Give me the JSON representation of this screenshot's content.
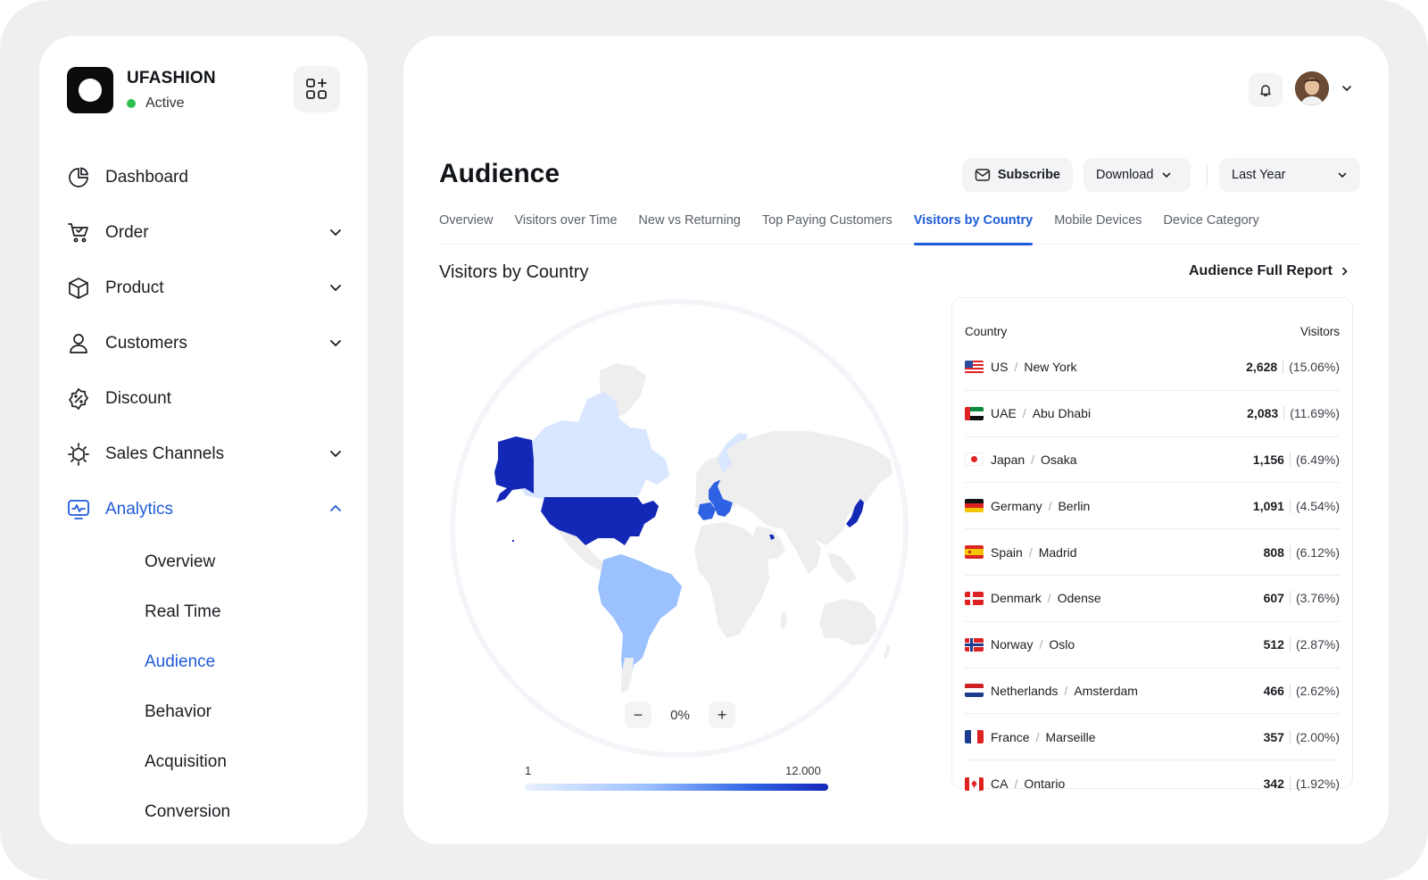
{
  "brand": {
    "name": "UFASHION",
    "status": "Active"
  },
  "nav": [
    {
      "label": "Dashboard",
      "icon": "pie-chart-icon",
      "expandable": false
    },
    {
      "label": "Order",
      "icon": "cart-icon",
      "expandable": true
    },
    {
      "label": "Product",
      "icon": "box-icon",
      "expandable": true
    },
    {
      "label": "Customers",
      "icon": "user-icon",
      "expandable": true
    },
    {
      "label": "Discount",
      "icon": "discount-badge-icon",
      "expandable": false
    },
    {
      "label": "Sales Channels",
      "icon": "channels-icon",
      "expandable": true
    },
    {
      "label": "Analytics",
      "icon": "analytics-monitor-icon",
      "expandable": true,
      "expanded": true
    }
  ],
  "analytics_sub": [
    "Overview",
    "Real Time",
    "Audience",
    "Behavior",
    "Acquisition",
    "Conversion"
  ],
  "analytics_sub_active": "Audience",
  "header": {
    "title": "Audience",
    "subscribe": "Subscribe",
    "download": "Download",
    "period": "Last Year"
  },
  "tabs": [
    "Overview",
    "Visitors over Time",
    "New vs Returning",
    "Top Paying Customers",
    "Visitors by Country",
    "Mobile Devices",
    "Device Category"
  ],
  "active_tab": "Visitors by Country",
  "section": {
    "title": "Visitors by Country",
    "report_link": "Audience Full Report"
  },
  "map": {
    "zoom": "0%",
    "legend_min": "1",
    "legend_max": "12.000"
  },
  "table": {
    "col_country": "Country",
    "col_visitors": "Visitors",
    "rows": [
      {
        "country": "US",
        "city": "New York",
        "visitors": "2,628",
        "pct": "(15.06%)",
        "flag": "us"
      },
      {
        "country": "UAE",
        "city": "Abu Dhabi",
        "visitors": "2,083",
        "pct": "(11.69%)",
        "flag": "ae"
      },
      {
        "country": "Japan",
        "city": "Osaka",
        "visitors": "1,156",
        "pct": "(6.49%)",
        "flag": "jp"
      },
      {
        "country": "Germany",
        "city": "Berlin",
        "visitors": "1,091",
        "pct": "(4.54%)",
        "flag": "de"
      },
      {
        "country": "Spain",
        "city": "Madrid",
        "visitors": "808",
        "pct": "(6.12%)",
        "flag": "es"
      },
      {
        "country": "Denmark",
        "city": "Odense",
        "visitors": "607",
        "pct": "(3.76%)",
        "flag": "dk"
      },
      {
        "country": "Norway",
        "city": "Oslo",
        "visitors": "512",
        "pct": "(2.87%)",
        "flag": "no"
      },
      {
        "country": "Netherlands",
        "city": "Amsterdam",
        "visitors": "466",
        "pct": "(2.62%)",
        "flag": "nl"
      },
      {
        "country": "France",
        "city": "Marseille",
        "visitors": "357",
        "pct": "(2.00%)",
        "flag": "fr"
      },
      {
        "country": "CA",
        "city": "Ontario",
        "visitors": "342",
        "pct": "(1.92%)",
        "flag": "ca"
      }
    ]
  },
  "colors": {
    "accent": "#1e5bd8",
    "status_active": "#2fbf4f",
    "map_high": "#1428b8",
    "map_mid": "#9cc1ff",
    "map_low": "#d9e6ff",
    "map_none": "#eeeeee"
  }
}
